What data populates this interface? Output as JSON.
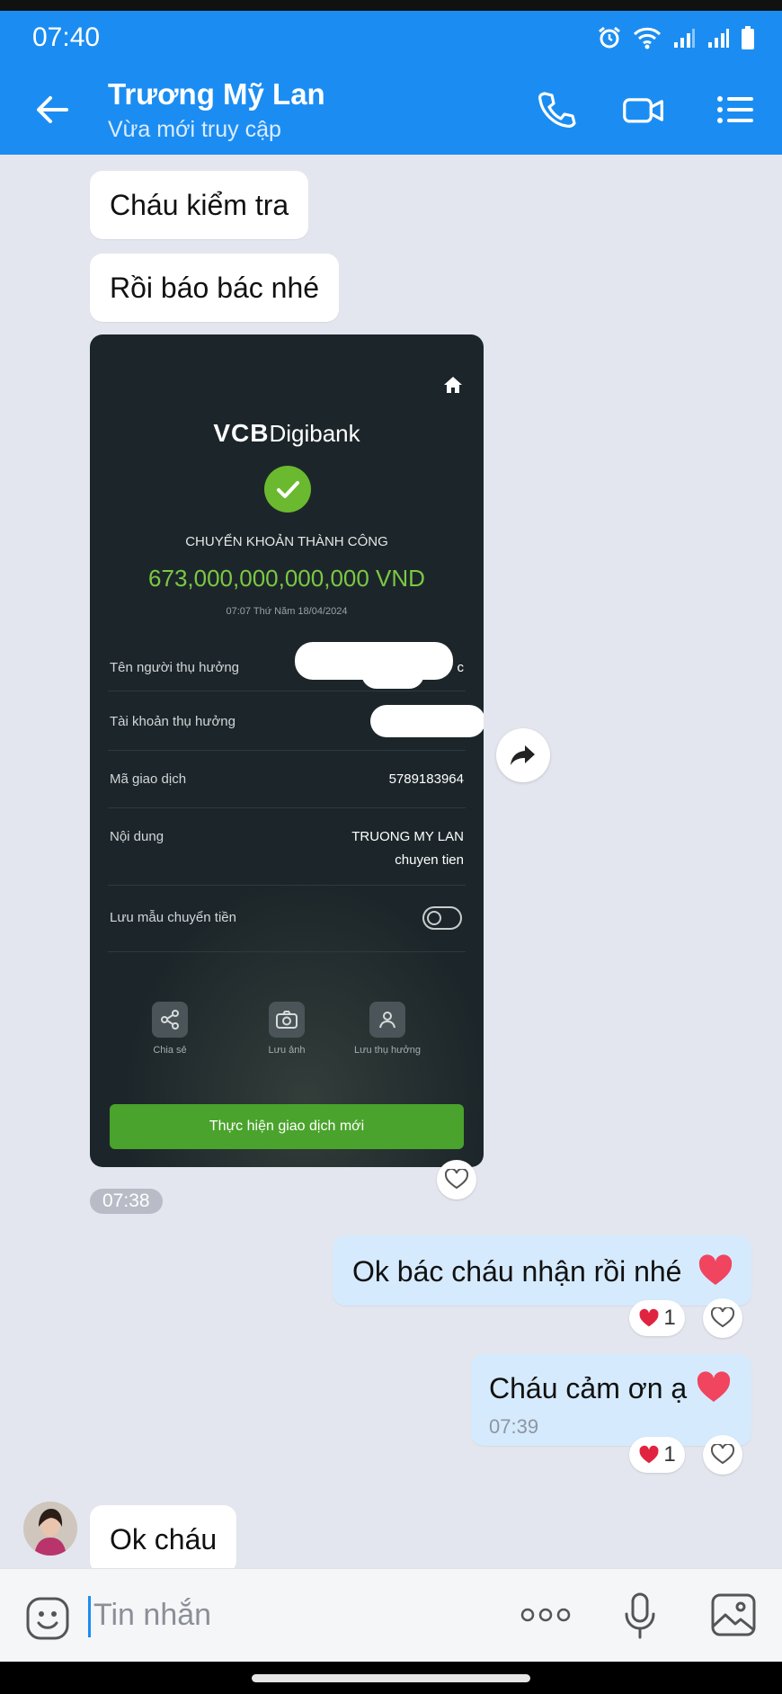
{
  "status_bar": {
    "time": "07:40",
    "icons": [
      "alarm-icon",
      "wifi-icon",
      "signal-icon",
      "signal-icon",
      "battery-icon"
    ]
  },
  "header": {
    "contact_name": "Trương Mỹ Lan",
    "contact_status": "Vừa mới truy cập",
    "back_icon": "arrow-left-icon",
    "actions": [
      "phone-icon",
      "video-call-icon",
      "menu-list-icon"
    ],
    "background_color": "#1b8df2"
  },
  "messages": {
    "m1": {
      "text": "Cháu kiểm tra"
    },
    "m2": {
      "text": "Rồi báo bác nhé"
    },
    "receipt": {
      "brand_bold": "VCB",
      "brand_rest": "Digibank",
      "title": "CHUYỂN KHOẢN THÀNH CÔNG",
      "amount": "673,000,000,000,000 VND",
      "datetime": "07:07 Thứ Năm 18/04/2024",
      "rows": {
        "beneficiary_name": {
          "label": "Tên người thụ hưởng",
          "value_tail": "c"
        },
        "beneficiary_account": {
          "label": "Tài khoản thụ hưởng"
        },
        "transaction_id": {
          "label": "Mã giao dịch",
          "value": "5789183964"
        },
        "content": {
          "label": "Nội dung",
          "value_line1": "TRUONG MY LAN",
          "value_line2": "chuyen tien"
        },
        "save_template": {
          "label": "Lưu mẫu chuyển tiền",
          "toggle_on": false
        }
      },
      "actions": {
        "share": "Chia sẻ",
        "save_image": "Lưu ảnh",
        "save_beneficiary": "Lưu thụ hưởng"
      },
      "cta": "Thực hiện giao dịch mới",
      "accent_color": "#6ab92f"
    },
    "receipt_time": "07:38",
    "m3": {
      "text": "Ok bác cháu nhận rồi nhé",
      "emoji": "heart-icon",
      "reaction_count": "1"
    },
    "m4": {
      "text": "Cháu cảm ơn ạ",
      "emoji": "heart-icon",
      "time": "07:39",
      "reaction_count": "1"
    },
    "m5": {
      "text": "Ok cháu"
    }
  },
  "composer": {
    "placeholder": "Tin nhắn",
    "icons": [
      "sticker-icon",
      "more-icon",
      "microphone-icon",
      "image-icon"
    ]
  }
}
